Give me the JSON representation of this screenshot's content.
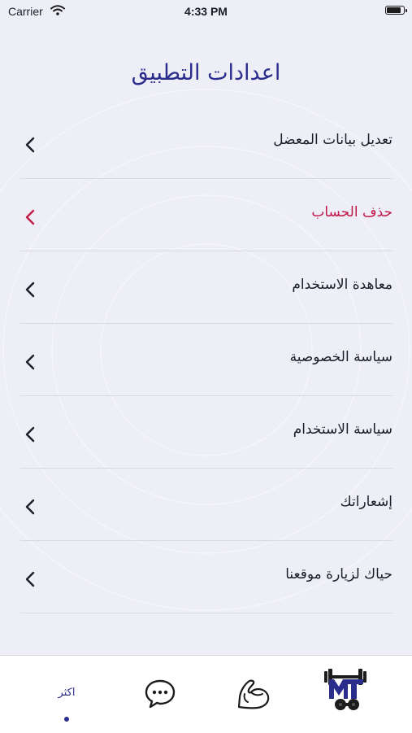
{
  "status_bar": {
    "carrier": "Carrier",
    "time": "4:33 PM",
    "battery_level": 0.9
  },
  "page": {
    "title": "اعدادات التطبيق"
  },
  "settings": {
    "items": [
      {
        "label": "تعديل بيانات المعضل",
        "color": "#1c1c2a"
      },
      {
        "label": "حذف الحساب",
        "color": "#c2184a"
      },
      {
        "label": "معاهدة الاستخدام",
        "color": "#1c1c2a"
      },
      {
        "label": "سياسة الخصوصية",
        "color": "#1c1c2a"
      },
      {
        "label": "سياسة الاستخدام",
        "color": "#1c1c2a"
      },
      {
        "label": "إشعاراتك",
        "color": "#1c1c2a"
      },
      {
        "label": "حياك لزيارة موقعنا",
        "color": "#1c1c2a"
      }
    ]
  },
  "tab_bar": {
    "more_label": "اكثر",
    "accent_color": "#2a2d8c",
    "icons": [
      "more-tab",
      "chat-bubble-icon",
      "flexed-arm-icon",
      "mt-logo-icon"
    ]
  }
}
